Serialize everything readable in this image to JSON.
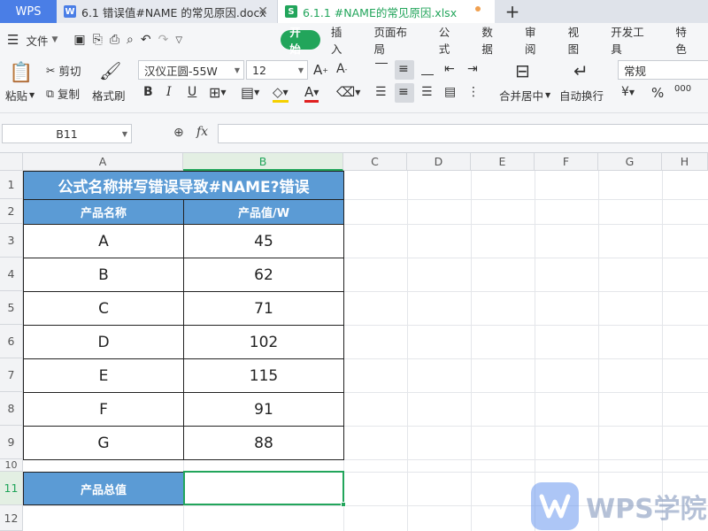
{
  "tabs": {
    "wps_label": "WPS",
    "doc": {
      "icon": "W",
      "title": "6.1 错误值#NAME 的常见原因.docx"
    },
    "xls": {
      "icon": "S",
      "title": "6.1.1 #NAME的常见原因.xlsx"
    },
    "add": "+"
  },
  "menu": {
    "file": "文件",
    "tabs": [
      "开始",
      "插入",
      "页面布局",
      "公式",
      "数据",
      "审阅",
      "视图",
      "开发工具",
      "特色"
    ]
  },
  "ribbon": {
    "paste": "粘贴",
    "cut": "剪切",
    "copy": "复制",
    "format_painter": "格式刷",
    "font_name": "汉仪正圆-55W",
    "font_size": "12",
    "bold": "B",
    "italic": "I",
    "underline": "U",
    "merge_center": "合并居中",
    "wrap_text": "自动换行",
    "number_format": "常规",
    "currency": "¥",
    "percent": "%",
    "thousands": "000"
  },
  "formula_bar": {
    "cell_ref": "B11",
    "fx": "fx",
    "formula": ""
  },
  "sheet": {
    "columns": [
      "A",
      "B",
      "C",
      "D",
      "E",
      "F",
      "G",
      "H"
    ],
    "rows": [
      "1",
      "2",
      "3",
      "4",
      "5",
      "6",
      "7",
      "8",
      "9",
      "10",
      "11",
      "12"
    ],
    "title": "公式名称拼写错误导致#NAME?错误",
    "header_name": "产品名称",
    "header_value": "产品值/W",
    "data": [
      {
        "name": "A",
        "value": "45"
      },
      {
        "name": "B",
        "value": "62"
      },
      {
        "name": "C",
        "value": "71"
      },
      {
        "name": "D",
        "value": "102"
      },
      {
        "name": "E",
        "value": "115"
      },
      {
        "name": "F",
        "value": "91"
      },
      {
        "name": "G",
        "value": "88"
      }
    ],
    "total_label": "产品总值",
    "total_value": ""
  },
  "watermark": "WPS学院",
  "colors": {
    "accent_green": "#22a55b",
    "header_blue": "#5b9bd5",
    "wps_blue": "#4a7ee6"
  }
}
